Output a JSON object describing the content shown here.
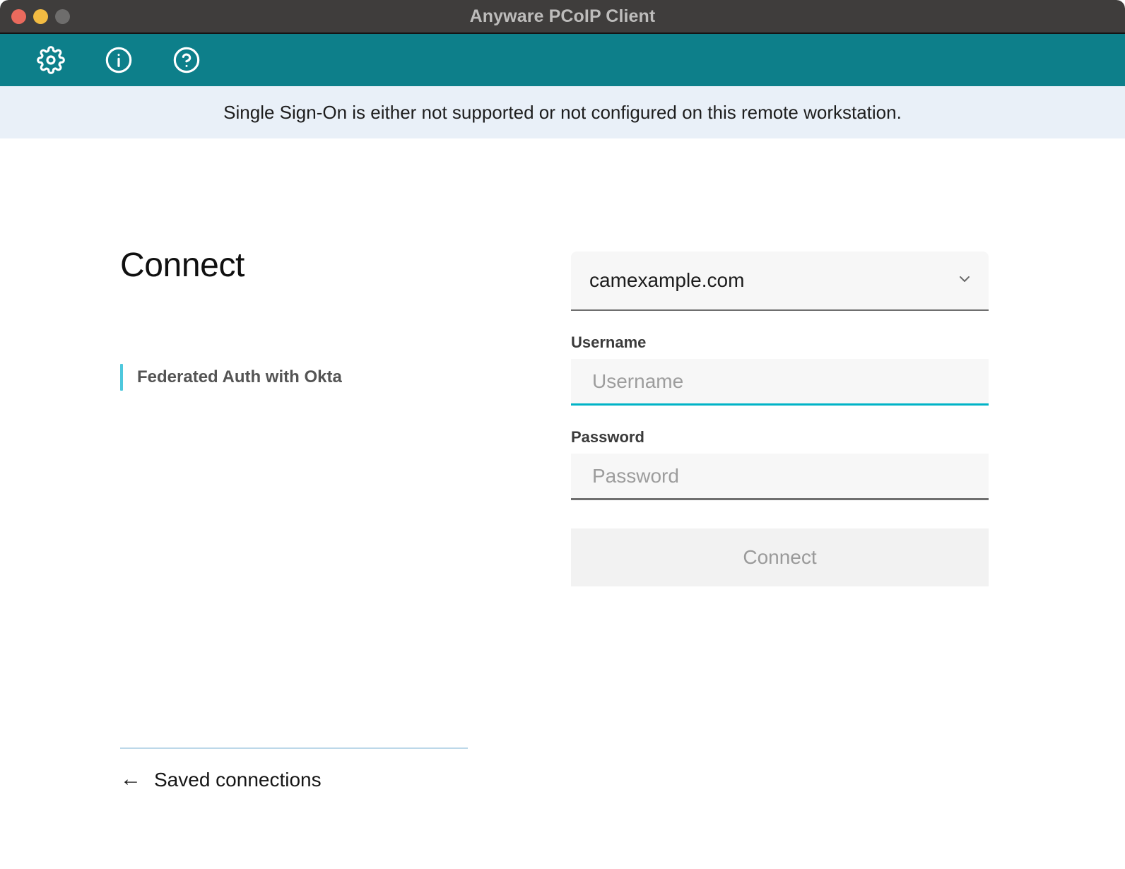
{
  "window": {
    "title": "Anyware PCoIP Client",
    "controls": {
      "close": "close-window",
      "minimize": "minimize-window",
      "maximize": "maximize-window"
    }
  },
  "toolbar": {
    "items": [
      {
        "icon": "gear-icon",
        "name": "settings-button"
      },
      {
        "icon": "info-icon",
        "name": "info-button"
      },
      {
        "icon": "help-icon",
        "name": "help-button"
      }
    ]
  },
  "banner": {
    "message": "Single Sign-On is either not supported or not configured on this remote workstation."
  },
  "main": {
    "page_title": "Connect",
    "auth_methods": [
      {
        "label": "Federated Auth with Okta",
        "selected": true
      }
    ],
    "saved_connections": {
      "arrow": "←",
      "label": "Saved connections"
    }
  },
  "form": {
    "host_select": {
      "value": "camexample.com",
      "chevron": "chevron-down-icon"
    },
    "username": {
      "label": "Username",
      "placeholder": "Username",
      "value": "",
      "focused": true
    },
    "password": {
      "label": "Password",
      "placeholder": "Password",
      "value": "",
      "focused": false
    },
    "submit": {
      "label": "Connect",
      "disabled": true
    }
  },
  "colors": {
    "titlebar": "#3f3d3c",
    "toolbar_teal": "#0d7f8a",
    "banner_blue": "#e9f0f8",
    "accent_cyan": "#4ec8dd",
    "focus_underline": "#00b3c6",
    "divider_blue": "#bcd8e9",
    "traffic_close": "#ea6a5d",
    "traffic_min": "#f2bb42",
    "traffic_max": "#6e6d6c"
  }
}
